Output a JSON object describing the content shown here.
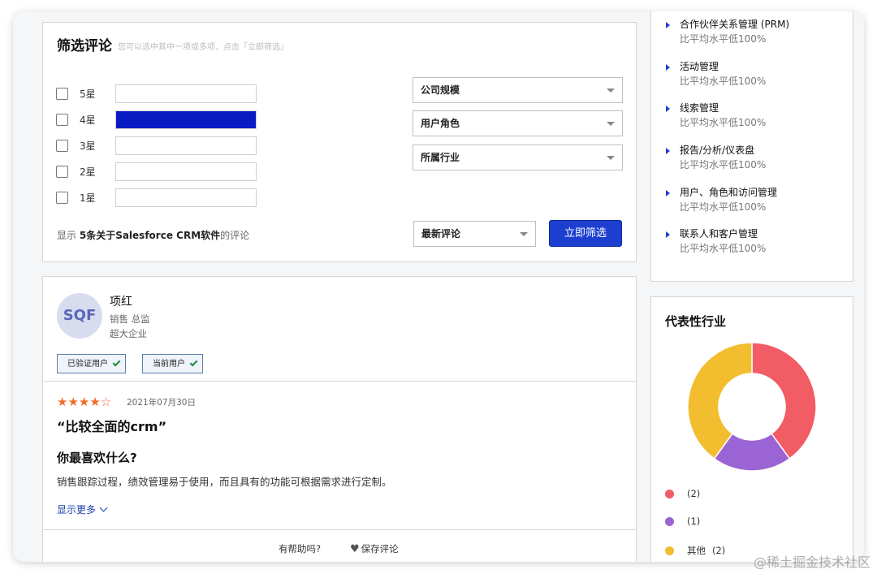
{
  "filter": {
    "title": "筛选评论",
    "hint": "您可以选中其中一项或多项，点击「立即筛选」",
    "ratings": [
      {
        "label": "5星",
        "fraction": 0
      },
      {
        "label": "4星",
        "fraction": 1
      },
      {
        "label": "3星",
        "fraction": 0
      },
      {
        "label": "2星",
        "fraction": 0
      },
      {
        "label": "1星",
        "fraction": 0
      }
    ],
    "dropdowns": {
      "company_size": "公司规模",
      "user_role": "用户角色",
      "industry": "所属行业"
    },
    "count_prefix": "显示",
    "count_bold": "5条关于Salesforce CRM软件",
    "count_suffix": "的评论",
    "sort": "最新评论",
    "submit": "立即筛选"
  },
  "review": {
    "avatar": "SQF",
    "name": "项红",
    "role": "销售 总监",
    "company": "超大企业",
    "badges": [
      "已验证用户",
      "当前用户"
    ],
    "rating": 4,
    "rating_max": 5,
    "stars_full": "★★★★",
    "stars_empty": "☆",
    "date": "2021年07月30日",
    "title": "“比较全面的crm”",
    "question": "你最喜欢什么?",
    "answer": "销售跟踪过程，绩效管理易于使用，而且具有的功能可根据需求进行定制。",
    "more": "显示更多",
    "helpful": "有帮助吗?",
    "save": "保存评论"
  },
  "features": [
    {
      "name": "合作伙伴关系管理 (PRM)",
      "sub": "比平均水平低100%"
    },
    {
      "name": "活动管理",
      "sub": "比平均水平低100%"
    },
    {
      "name": "线索管理",
      "sub": "比平均水平低100%"
    },
    {
      "name": "报告/分析/仪表盘",
      "sub": "比平均水平低100%"
    },
    {
      "name": "用户、角色和访问管理",
      "sub": "比平均水平低100%"
    },
    {
      "name": "联系人和客户管理",
      "sub": "比平均水平低100%"
    }
  ],
  "industry": {
    "title": "代表性行业",
    "legend": [
      {
        "label": "",
        "count": "(2)",
        "color": "#f25c64"
      },
      {
        "label": "",
        "count": "(1)",
        "color": "#9b64d4"
      },
      {
        "label": "其他",
        "count": "(2)",
        "color": "#f2bd2f"
      }
    ]
  },
  "chart_data": {
    "type": "pie",
    "categories": [
      "",
      "",
      "其他"
    ],
    "values": [
      2,
      1,
      2
    ],
    "colors": [
      "#f25c64",
      "#9b64d4",
      "#f2bd2f"
    ],
    "title": "代表性行业"
  },
  "watermark": "@稀土掘金技术社区"
}
